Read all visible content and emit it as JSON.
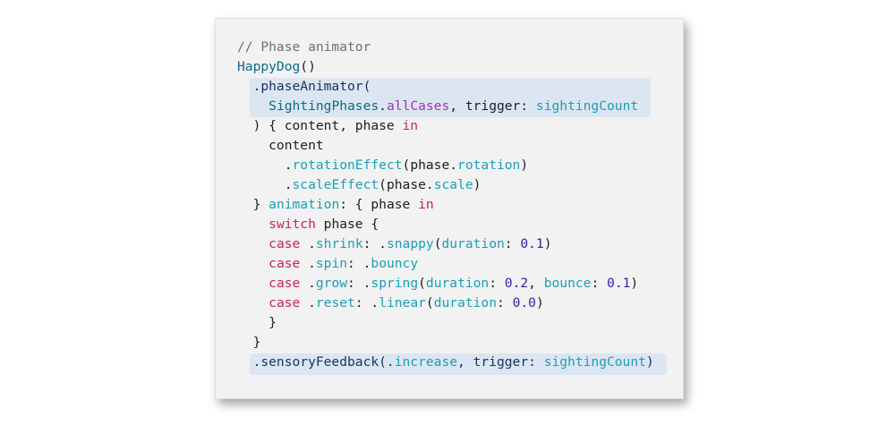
{
  "code": {
    "lines": [
      [
        {
          "t": "// Phase animator",
          "c": "comment"
        }
      ],
      [
        {
          "t": "HappyDog",
          "c": "type"
        },
        {
          "t": "()",
          "c": "plain"
        }
      ],
      [
        {
          "t": "  .phaseAnimator(",
          "c": "dark"
        }
      ],
      [
        {
          "t": "    ",
          "c": "plain"
        },
        {
          "t": "SightingPhases",
          "c": "type"
        },
        {
          "t": ".",
          "c": "plain"
        },
        {
          "t": "allCases",
          "c": "prop"
        },
        {
          "t": ", trigger: ",
          "c": "plain"
        },
        {
          "t": "sightingCount",
          "c": "member"
        }
      ],
      [
        {
          "t": "  ) { content, phase ",
          "c": "plain"
        },
        {
          "t": "in",
          "c": "kw"
        }
      ],
      [
        {
          "t": "    content",
          "c": "plain"
        }
      ],
      [
        {
          "t": "      .",
          "c": "plain"
        },
        {
          "t": "rotationEffect",
          "c": "member"
        },
        {
          "t": "(phase.",
          "c": "plain"
        },
        {
          "t": "rotation",
          "c": "member"
        },
        {
          "t": ")",
          "c": "plain"
        }
      ],
      [
        {
          "t": "      .",
          "c": "plain"
        },
        {
          "t": "scaleEffect",
          "c": "member"
        },
        {
          "t": "(phase.",
          "c": "plain"
        },
        {
          "t": "scale",
          "c": "member"
        },
        {
          "t": ")",
          "c": "plain"
        }
      ],
      [
        {
          "t": "  } ",
          "c": "plain"
        },
        {
          "t": "animation",
          "c": "member"
        },
        {
          "t": ": { phase ",
          "c": "plain"
        },
        {
          "t": "in",
          "c": "kw"
        }
      ],
      [
        {
          "t": "    ",
          "c": "plain"
        },
        {
          "t": "switch",
          "c": "kw"
        },
        {
          "t": " phase {",
          "c": "plain"
        }
      ],
      [
        {
          "t": "    ",
          "c": "plain"
        },
        {
          "t": "case",
          "c": "kw"
        },
        {
          "t": " .",
          "c": "plain"
        },
        {
          "t": "shrink",
          "c": "member"
        },
        {
          "t": ": .",
          "c": "plain"
        },
        {
          "t": "snappy",
          "c": "member"
        },
        {
          "t": "(",
          "c": "plain"
        },
        {
          "t": "duration",
          "c": "member"
        },
        {
          "t": ": ",
          "c": "plain"
        },
        {
          "t": "0.1",
          "c": "num"
        },
        {
          "t": ")",
          "c": "plain"
        }
      ],
      [
        {
          "t": "    ",
          "c": "plain"
        },
        {
          "t": "case",
          "c": "kw"
        },
        {
          "t": " .",
          "c": "plain"
        },
        {
          "t": "spin",
          "c": "member"
        },
        {
          "t": ": .",
          "c": "plain"
        },
        {
          "t": "bouncy",
          "c": "member"
        }
      ],
      [
        {
          "t": "    ",
          "c": "plain"
        },
        {
          "t": "case",
          "c": "kw"
        },
        {
          "t": " .",
          "c": "plain"
        },
        {
          "t": "grow",
          "c": "member"
        },
        {
          "t": ": .",
          "c": "plain"
        },
        {
          "t": "spring",
          "c": "member"
        },
        {
          "t": "(",
          "c": "plain"
        },
        {
          "t": "duration",
          "c": "member"
        },
        {
          "t": ": ",
          "c": "plain"
        },
        {
          "t": "0.2",
          "c": "num"
        },
        {
          "t": ", ",
          "c": "plain"
        },
        {
          "t": "bounce",
          "c": "member"
        },
        {
          "t": ": ",
          "c": "plain"
        },
        {
          "t": "0.1",
          "c": "num"
        },
        {
          "t": ")",
          "c": "plain"
        }
      ],
      [
        {
          "t": "    ",
          "c": "plain"
        },
        {
          "t": "case",
          "c": "kw"
        },
        {
          "t": " .",
          "c": "plain"
        },
        {
          "t": "reset",
          "c": "member"
        },
        {
          "t": ": .",
          "c": "plain"
        },
        {
          "t": "linear",
          "c": "member"
        },
        {
          "t": "(",
          "c": "plain"
        },
        {
          "t": "duration",
          "c": "member"
        },
        {
          "t": ": ",
          "c": "plain"
        },
        {
          "t": "0.0",
          "c": "num"
        },
        {
          "t": ")",
          "c": "plain"
        }
      ],
      [
        {
          "t": "    }",
          "c": "plain"
        }
      ],
      [
        {
          "t": "  }",
          "c": "plain"
        }
      ],
      [
        {
          "t": "  .sensoryFeedback(.",
          "c": "dark"
        },
        {
          "t": "increase",
          "c": "member"
        },
        {
          "t": ", trigger: ",
          "c": "dark"
        },
        {
          "t": "sightingCount",
          "c": "member"
        },
        {
          "t": ")",
          "c": "dark"
        }
      ]
    ]
  },
  "colors": {
    "card_background": "#f2f2f3",
    "highlight": "#dce6f2",
    "keyword": "#c8225c",
    "member": "#1a9fb5",
    "type": "#0b6b86",
    "property": "#9a33b8",
    "number": "#2c24a6",
    "comment": "#6e6e73"
  }
}
